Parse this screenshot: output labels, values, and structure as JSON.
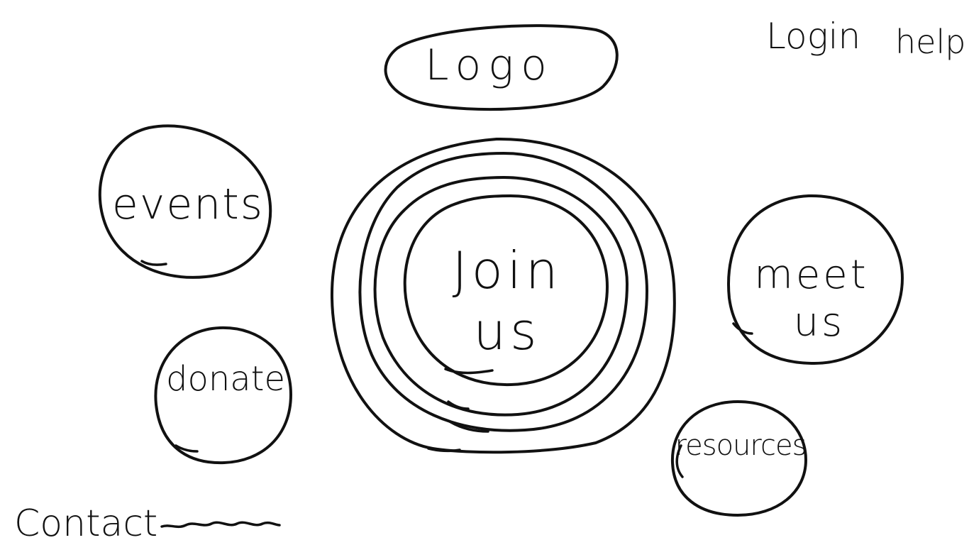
{
  "header": {
    "logo_label": "Logo",
    "login_label": "Login",
    "help_label": "help"
  },
  "nav": {
    "events_label": "events",
    "join_label": "Join\nus",
    "meet_label": "meet\n us",
    "donate_label": "donate",
    "resources_label": "resources"
  },
  "footer": {
    "contact_label": "Contact"
  },
  "colors": {
    "stroke": "#111111",
    "background": "#ffffff"
  }
}
